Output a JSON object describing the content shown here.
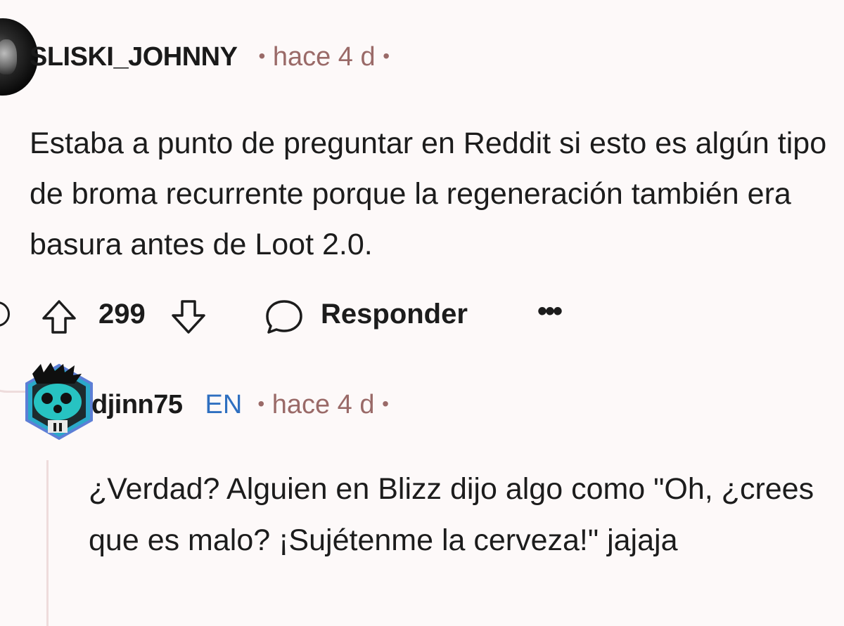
{
  "comment": {
    "username": "SLISKI_JOHNNY",
    "time": "hace 4 d",
    "separator": "•",
    "body": "Estaba a punto de preguntar en Reddit si esto es algún tipo de broma recurrente porque la regeneración también era basura antes de Loot 2.0."
  },
  "actions": {
    "score": "299",
    "reply_label": "Responder",
    "more_label": "•••"
  },
  "reply": {
    "username": "djinn75",
    "flair": "EN",
    "time": "hace 4 d",
    "separator": "•",
    "body": "¿Verdad? Alguien en Blizz dijo algo como \"Oh, ¿crees que es malo? ¡Sujétenme la cerveza!\" jajaja"
  },
  "colors": {
    "background": "#fdf9f9",
    "meta_text": "#9a6a68",
    "flair_text": "#2e6fc0",
    "thread_line": "#eedcdc",
    "avatar2_teal": "#27c3c2"
  },
  "icons": {
    "avatar1": "user-photo-avatar",
    "avatar2": "snoo-avatar-hexagon",
    "upvote": "arrow-up-icon",
    "downvote": "arrow-down-icon",
    "reply": "speech-bubble-icon",
    "more": "ellipsis-icon"
  }
}
